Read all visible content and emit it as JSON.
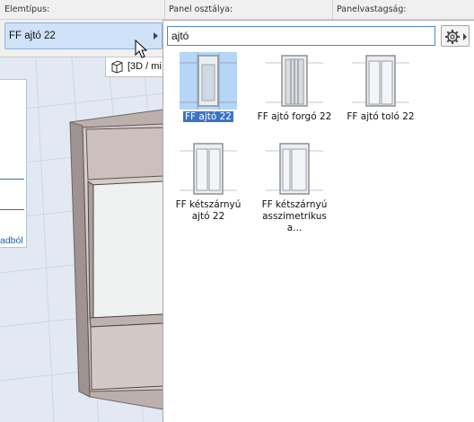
{
  "header": {
    "element_type_label": "Elemtípus:",
    "panel_class_label": "Panel osztálya:",
    "panel_thickness_label": "Panelvastagság:"
  },
  "element_type_dropdown": {
    "value": "FF ajtó 22"
  },
  "view3d_tab": {
    "label": "[3D / mi"
  },
  "left_panel": {
    "link_text": "adból"
  },
  "search": {
    "value": "ajtó",
    "placeholder": ""
  },
  "library_items": [
    {
      "label": "FF ajtó 22",
      "selected": true,
      "icon": "single-door-thumb"
    },
    {
      "label": "FF ajtó forgó 22",
      "selected": false,
      "icon": "revolving-door-thumb"
    },
    {
      "label": "FF ajtó toló 22",
      "selected": false,
      "icon": "sliding-door-thumb"
    },
    {
      "label": "FF kétszárnyú ajtó 22",
      "selected": false,
      "icon": "double-door-thumb"
    },
    {
      "label": "FF kétszárnyú asszimetrikus a...",
      "selected": false,
      "icon": "asymmetric-double-door-thumb"
    }
  ],
  "colors": {
    "selection": "#3b74c7",
    "thumb_selected_bg": "#b5d6f7",
    "dropdown_bg": "#cfe2f8"
  }
}
